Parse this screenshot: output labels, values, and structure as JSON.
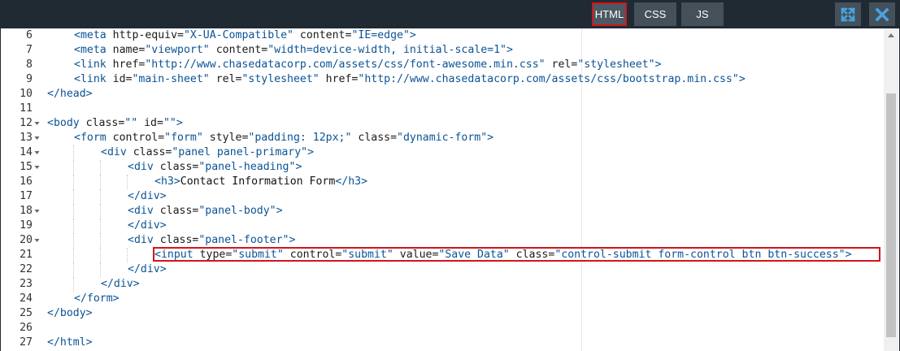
{
  "tabs": [
    {
      "label": "HTML",
      "active": true
    },
    {
      "label": "CSS",
      "active": false
    },
    {
      "label": "JS",
      "active": false
    }
  ],
  "toolbar": {
    "expand_icon": "expand-icon",
    "close_icon": "close-icon"
  },
  "colors": {
    "topbar": "#1f2a33",
    "tab": "#44505a",
    "highlight": "#d0161c",
    "icon": "#4aa3df"
  },
  "lines": [
    {
      "n": "6",
      "fold": false,
      "indent": 1,
      "tokens": [
        [
          "tag",
          "<meta "
        ],
        [
          "attr",
          "http-equiv="
        ],
        [
          "str",
          "\"X-UA-Compatible\""
        ],
        [
          "attr",
          " content="
        ],
        [
          "str",
          "\"IE=edge\""
        ],
        [
          "tag",
          ">"
        ]
      ]
    },
    {
      "n": "7",
      "fold": false,
      "indent": 1,
      "tokens": [
        [
          "tag",
          "<meta "
        ],
        [
          "attr",
          "name="
        ],
        [
          "str",
          "\"viewport\""
        ],
        [
          "attr",
          " content="
        ],
        [
          "str",
          "\"width=device-width, initial-scale=1\""
        ],
        [
          "tag",
          ">"
        ]
      ]
    },
    {
      "n": "8",
      "fold": false,
      "indent": 1,
      "tokens": [
        [
          "tag",
          "<link "
        ],
        [
          "attr",
          "href="
        ],
        [
          "str",
          "\"http://www.chasedatacorp.com/assets/css/font-awesome.min.css\""
        ],
        [
          "attr",
          " rel="
        ],
        [
          "str",
          "\"stylesheet\""
        ],
        [
          "tag",
          ">"
        ]
      ]
    },
    {
      "n": "9",
      "fold": false,
      "indent": 1,
      "tokens": [
        [
          "tag",
          "<link "
        ],
        [
          "attr",
          "id="
        ],
        [
          "str",
          "\"main-sheet\""
        ],
        [
          "attr",
          " rel="
        ],
        [
          "str",
          "\"stylesheet\""
        ],
        [
          "attr",
          " href="
        ],
        [
          "str",
          "\"http://www.chasedatacorp.com/assets/css/bootstrap.min.css\""
        ],
        [
          "tag",
          ">"
        ]
      ]
    },
    {
      "n": "10",
      "fold": false,
      "indent": 0,
      "tokens": [
        [
          "tag",
          "</head>"
        ]
      ]
    },
    {
      "n": "11",
      "fold": false,
      "indent": 0,
      "tokens": []
    },
    {
      "n": "12",
      "fold": true,
      "indent": 0,
      "tokens": [
        [
          "tag",
          "<body "
        ],
        [
          "attr",
          "class="
        ],
        [
          "str",
          "\"\""
        ],
        [
          "attr",
          " id="
        ],
        [
          "str",
          "\"\""
        ],
        [
          "tag",
          ">"
        ]
      ]
    },
    {
      "n": "13",
      "fold": true,
      "indent": 1,
      "tokens": [
        [
          "tag",
          "<form "
        ],
        [
          "attr",
          "control="
        ],
        [
          "str",
          "\"form\""
        ],
        [
          "attr",
          " style="
        ],
        [
          "str",
          "\"padding: 12px;\""
        ],
        [
          "attr",
          " class="
        ],
        [
          "str",
          "\"dynamic-form\""
        ],
        [
          "tag",
          ">"
        ]
      ]
    },
    {
      "n": "14",
      "fold": true,
      "indent": 2,
      "tokens": [
        [
          "tag",
          "<div "
        ],
        [
          "attr",
          "class="
        ],
        [
          "str",
          "\"panel panel-primary\""
        ],
        [
          "tag",
          ">"
        ]
      ]
    },
    {
      "n": "15",
      "fold": true,
      "indent": 3,
      "tokens": [
        [
          "tag",
          "<div "
        ],
        [
          "attr",
          "class="
        ],
        [
          "str",
          "\"panel-heading\""
        ],
        [
          "tag",
          ">"
        ]
      ]
    },
    {
      "n": "16",
      "fold": false,
      "indent": 4,
      "tokens": [
        [
          "tag",
          "<h3>"
        ],
        [
          "txt",
          "Contact Information Form"
        ],
        [
          "tag",
          "</h3>"
        ]
      ]
    },
    {
      "n": "17",
      "fold": false,
      "indent": 3,
      "tokens": [
        [
          "tag",
          "</div>"
        ]
      ]
    },
    {
      "n": "18",
      "fold": true,
      "indent": 3,
      "tokens": [
        [
          "tag",
          "<div "
        ],
        [
          "attr",
          "class="
        ],
        [
          "str",
          "\"panel-body\""
        ],
        [
          "tag",
          ">"
        ]
      ]
    },
    {
      "n": "19",
      "fold": false,
      "indent": 3,
      "tokens": [
        [
          "tag",
          "</div>"
        ]
      ]
    },
    {
      "n": "20",
      "fold": true,
      "indent": 3,
      "tokens": [
        [
          "tag",
          "<div "
        ],
        [
          "attr",
          "class="
        ],
        [
          "str",
          "\"panel-footer\""
        ],
        [
          "tag",
          ">"
        ]
      ]
    },
    {
      "n": "21",
      "fold": false,
      "indent": 4,
      "tokens": [
        [
          "tag",
          "<input "
        ],
        [
          "attr",
          "type="
        ],
        [
          "str",
          "\"submit\""
        ],
        [
          "attr",
          " control="
        ],
        [
          "str",
          "\"submit\""
        ],
        [
          "attr",
          " value="
        ],
        [
          "str",
          "\"Save Data\""
        ],
        [
          "attr",
          " class="
        ],
        [
          "str",
          "\"control-submit form-control btn btn-success\""
        ],
        [
          "tag",
          ">"
        ]
      ]
    },
    {
      "n": "22",
      "fold": false,
      "indent": 3,
      "tokens": [
        [
          "tag",
          "</div>"
        ]
      ]
    },
    {
      "n": "23",
      "fold": false,
      "indent": 2,
      "tokens": [
        [
          "tag",
          "</div>"
        ]
      ]
    },
    {
      "n": "24",
      "fold": false,
      "indent": 1,
      "tokens": [
        [
          "tag",
          "</form>"
        ]
      ]
    },
    {
      "n": "25",
      "fold": false,
      "indent": 0,
      "tokens": [
        [
          "tag",
          "</body>"
        ]
      ]
    },
    {
      "n": "26",
      "fold": false,
      "indent": 0,
      "tokens": []
    },
    {
      "n": "27",
      "fold": false,
      "indent": 0,
      "tokens": [
        [
          "tag",
          "</html>"
        ]
      ]
    }
  ]
}
